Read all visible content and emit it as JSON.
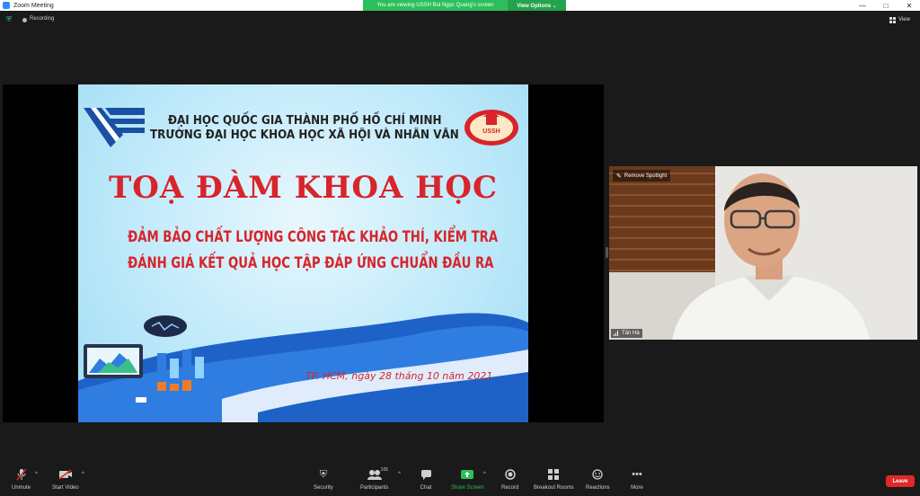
{
  "window": {
    "title": "Zoom Meeting",
    "controls": {
      "minimize": "—",
      "maximize": "□",
      "close": "✕"
    }
  },
  "banner": {
    "viewing": "You are viewing USSH Bùi Ngọc Quang's screen",
    "options": "View Options ⌄"
  },
  "status": {
    "recording": "Recording",
    "view": "View"
  },
  "slide": {
    "university_line1": "ĐẠI HỌC QUỐC GIA THÀNH PHỐ HỒ CHÍ MINH",
    "university_line2": "TRƯỜNG ĐẠI HỌC KHOA HỌC XÃ HỘI VÀ NHÂN VĂN",
    "seal_text": "USSH",
    "title": "TOẠ ĐÀM KHOA HỌC",
    "subtitle_line1": "ĐẢM BẢO CHẤT LƯỢNG CÔNG TÁC KHẢO THÍ, KIỂM TRA",
    "subtitle_line2": "ĐÁNH GIÁ KẾT QUẢ HỌC TẬP ĐÁP ỨNG CHUẨN ĐẦU RA",
    "date": "TP. HCM, ngày 28 tháng 10 năm 2021"
  },
  "video": {
    "spotlight": "Remove Spotlight",
    "participant_name": "Tấn Hà"
  },
  "toolbar": {
    "unmute": "Unmute",
    "start_video": "Start Video",
    "security": "Security",
    "participants": "Participants",
    "participants_count": "105",
    "chat": "Chat",
    "share_screen": "Share Screen",
    "record": "Record",
    "breakout_rooms": "Breakout Rooms",
    "reactions": "Reactions",
    "more": "More",
    "leave": "Leave"
  },
  "colors": {
    "accent_green": "#2bbf5b",
    "leave_red": "#e02828",
    "slide_title_red": "#d8242b",
    "background": "#1a1a1a"
  }
}
